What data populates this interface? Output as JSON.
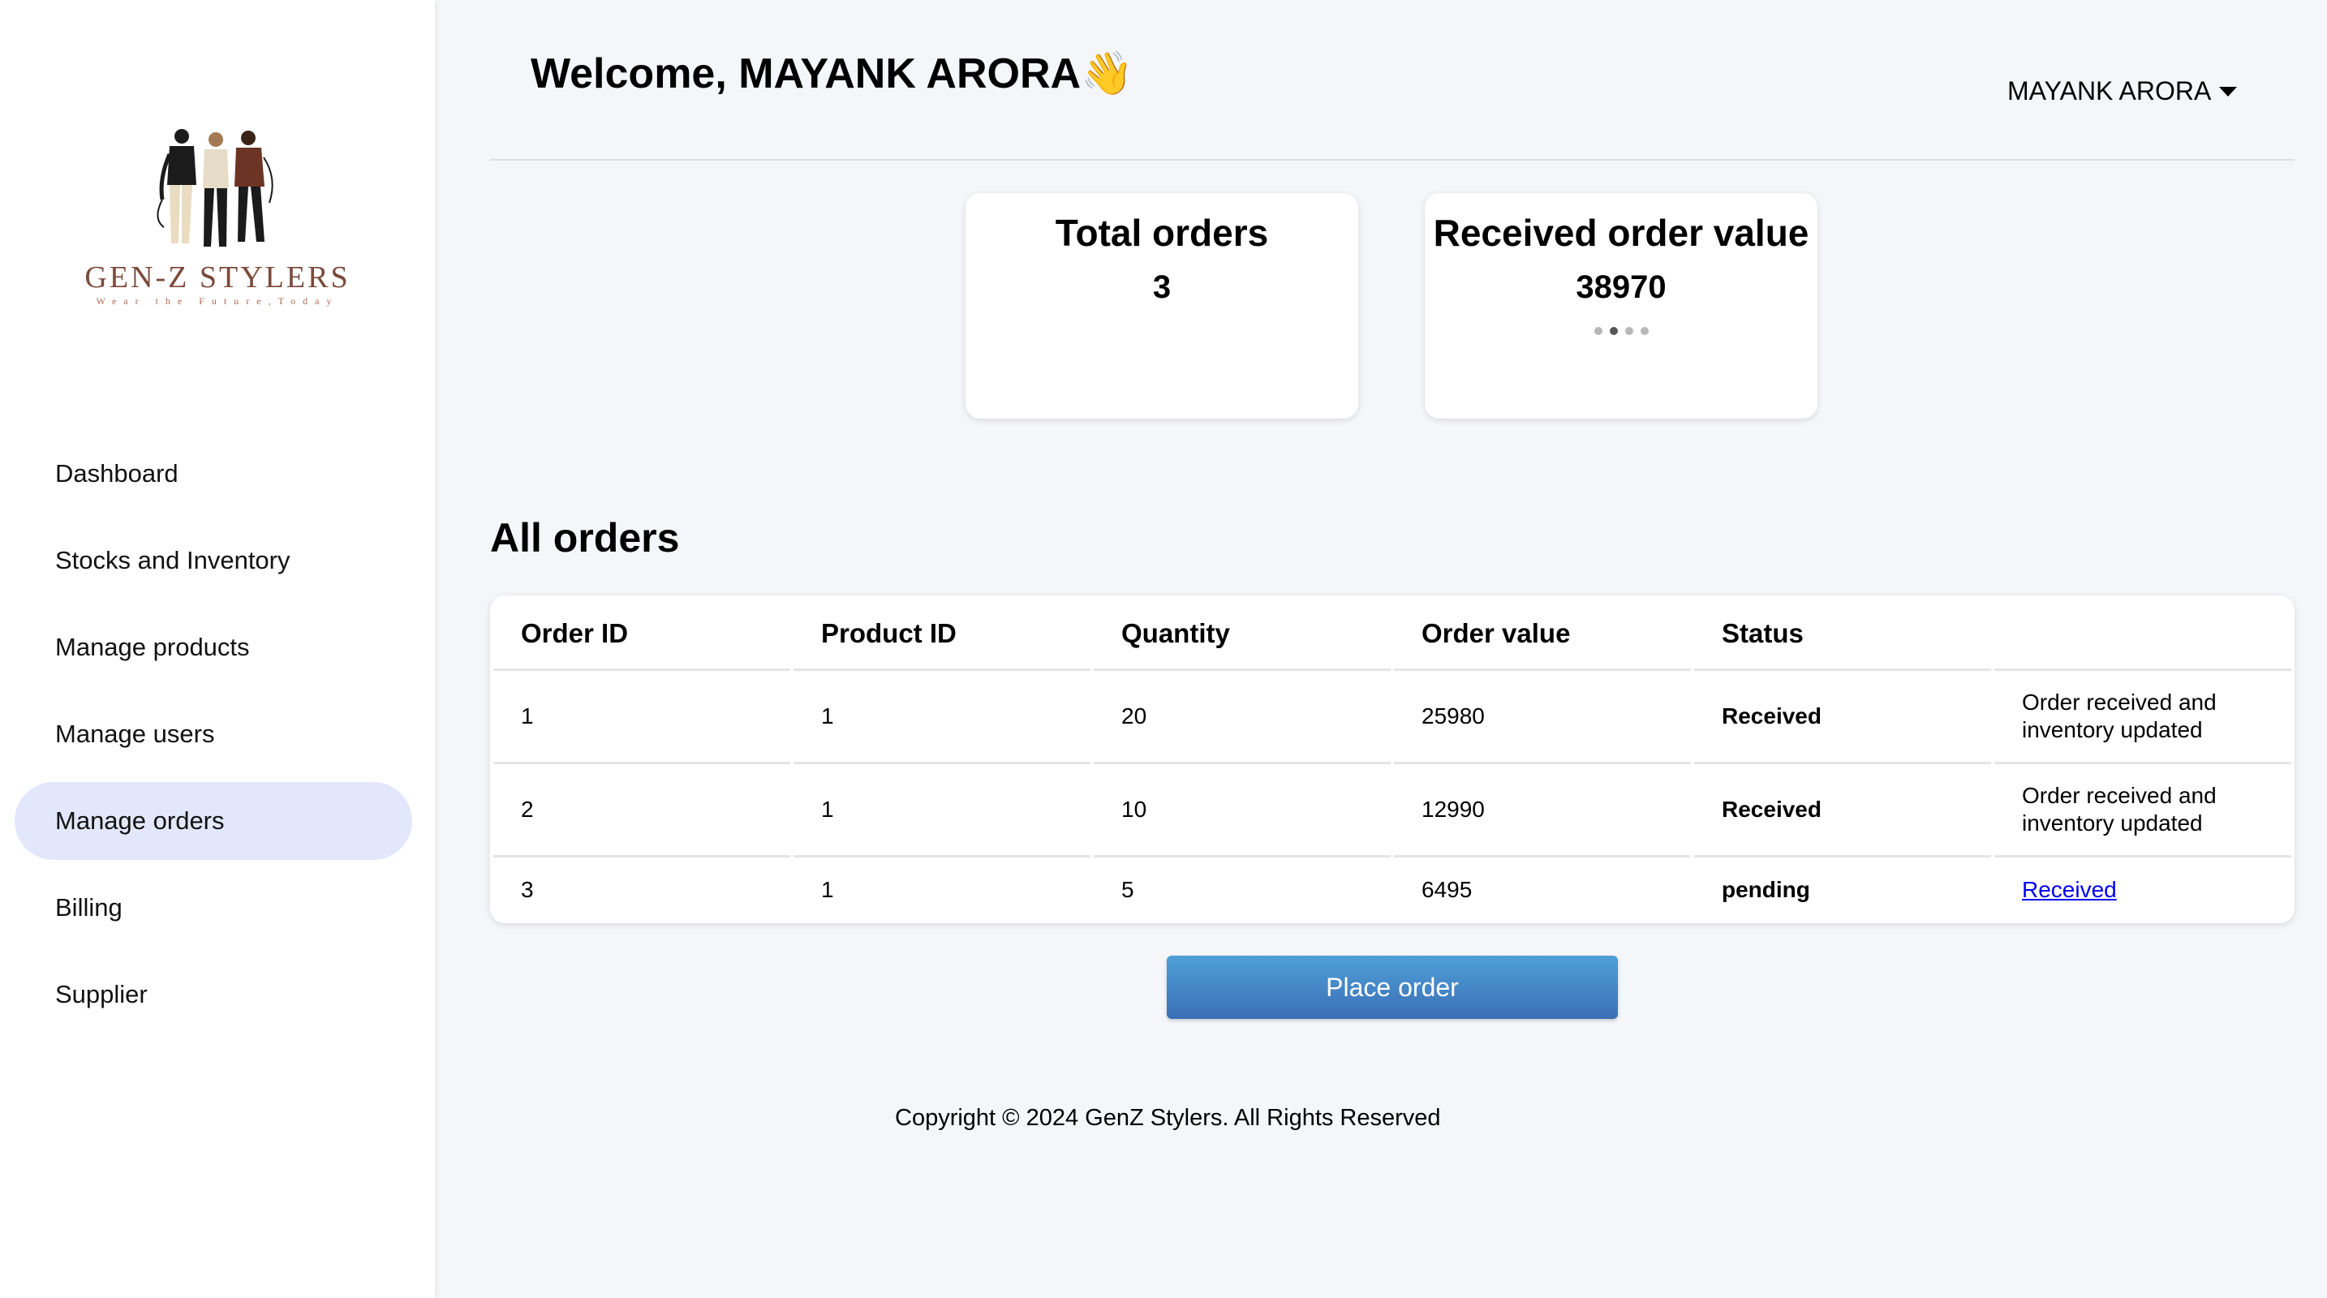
{
  "brand": {
    "name": "GEN-Z STYLERS",
    "tagline": "Wear the Future,Today"
  },
  "sidebar": {
    "items": [
      {
        "label": "Dashboard"
      },
      {
        "label": "Stocks and Inventory"
      },
      {
        "label": "Manage products"
      },
      {
        "label": "Manage users"
      },
      {
        "label": "Manage orders",
        "active": true
      },
      {
        "label": "Billing"
      },
      {
        "label": "Supplier"
      }
    ]
  },
  "header": {
    "welcome": "Welcome, MAYANK ARORA👋",
    "user_name": "MAYANK ARORA"
  },
  "stats": {
    "total_orders": {
      "label": "Total orders",
      "value": "3"
    },
    "received_value": {
      "label": "Received order value",
      "value": "38970"
    }
  },
  "orders": {
    "title": "All orders",
    "columns": [
      "Order ID",
      "Product ID",
      "Quantity",
      "Order value",
      "Status",
      ""
    ],
    "rows": [
      {
        "order_id": "1",
        "product_id": "1",
        "quantity": "20",
        "value": "25980",
        "status": "Received",
        "note": "Order received and inventory updated"
      },
      {
        "order_id": "2",
        "product_id": "1",
        "quantity": "10",
        "value": "12990",
        "status": "Received",
        "note": "Order received and inventory updated"
      },
      {
        "order_id": "3",
        "product_id": "1",
        "quantity": "5",
        "value": "6495",
        "status": "pending",
        "action": "Received"
      }
    ]
  },
  "actions": {
    "place_order": "Place order"
  },
  "footer": {
    "copyright": "Copyright © 2024 GenZ Stylers. All Rights Reserved"
  },
  "colors": {
    "accent": "#3b6fb6",
    "active_nav": "#e2e7fb",
    "background": "#f5f6fa"
  }
}
